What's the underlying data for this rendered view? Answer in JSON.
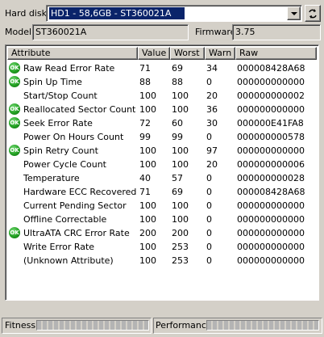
{
  "header": {
    "hard_disk_label": "Hard disk",
    "selected_disk": "HD1 - 58,6GB - ST360021A",
    "model_label": "Model",
    "model_value": "ST360021A",
    "firmware_label": "Firmware",
    "firmware_value": "3.75"
  },
  "table": {
    "columns": [
      "Attribute",
      "Value",
      "Worst",
      "Warn",
      "Raw"
    ],
    "rows": [
      {
        "ok": true,
        "attribute": "Raw Read Error Rate",
        "value": "71",
        "worst": "69",
        "warn": "34",
        "raw": "000008428A68"
      },
      {
        "ok": true,
        "attribute": "Spin Up Time",
        "value": "88",
        "worst": "88",
        "warn": "0",
        "raw": "000000000000"
      },
      {
        "ok": false,
        "attribute": "Start/Stop Count",
        "value": "100",
        "worst": "100",
        "warn": "20",
        "raw": "000000000002"
      },
      {
        "ok": true,
        "attribute": "Reallocated Sector Count",
        "value": "100",
        "worst": "100",
        "warn": "36",
        "raw": "000000000000"
      },
      {
        "ok": true,
        "attribute": "Seek Error Rate",
        "value": "72",
        "worst": "60",
        "warn": "30",
        "raw": "000000E41FA8"
      },
      {
        "ok": false,
        "attribute": "Power On Hours Count",
        "value": "99",
        "worst": "99",
        "warn": "0",
        "raw": "000000000578"
      },
      {
        "ok": true,
        "attribute": "Spin Retry Count",
        "value": "100",
        "worst": "100",
        "warn": "97",
        "raw": "000000000000"
      },
      {
        "ok": false,
        "attribute": "Power Cycle Count",
        "value": "100",
        "worst": "100",
        "warn": "20",
        "raw": "000000000006"
      },
      {
        "ok": false,
        "attribute": "Temperature",
        "value": "40",
        "worst": "57",
        "warn": "0",
        "raw": "000000000028"
      },
      {
        "ok": false,
        "attribute": "Hardware ECC Recovered",
        "value": "71",
        "worst": "69",
        "warn": "0",
        "raw": "000008428A68"
      },
      {
        "ok": false,
        "attribute": "Current Pending Sector",
        "value": "100",
        "worst": "100",
        "warn": "0",
        "raw": "000000000000"
      },
      {
        "ok": false,
        "attribute": "Offline Correctable",
        "value": "100",
        "worst": "100",
        "warn": "0",
        "raw": "000000000000"
      },
      {
        "ok": true,
        "attribute": "UltraATA CRC Error Rate",
        "value": "200",
        "worst": "200",
        "warn": "0",
        "raw": "000000000000"
      },
      {
        "ok": false,
        "attribute": "Write Error Rate",
        "value": "100",
        "worst": "253",
        "warn": "0",
        "raw": "000000000000"
      },
      {
        "ok": false,
        "attribute": "(Unknown Attribute)",
        "value": "100",
        "worst": "253",
        "warn": "0",
        "raw": "000000000000"
      }
    ],
    "ok_badge": "OK"
  },
  "status": {
    "fitness_label": "Fitness",
    "performance_label": "Performance"
  },
  "colors": {
    "face": "#d4d0c8",
    "selection": "#0a246a",
    "ok_green": "#22a022"
  }
}
